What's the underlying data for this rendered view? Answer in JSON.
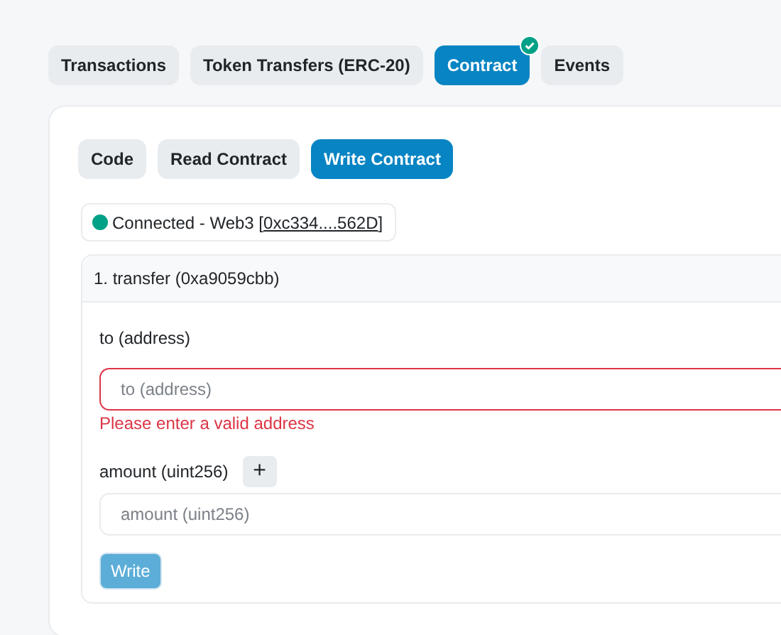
{
  "tabs": [
    {
      "label": "Transactions",
      "selected": false,
      "verified": false
    },
    {
      "label": "Token Transfers (ERC-20)",
      "selected": false,
      "verified": false
    },
    {
      "label": "Contract",
      "selected": true,
      "verified": true
    },
    {
      "label": "Events",
      "selected": false,
      "verified": false
    }
  ],
  "subtabs": [
    {
      "label": "Code",
      "selected": false
    },
    {
      "label": "Read Contract",
      "selected": false
    },
    {
      "label": "Write Contract",
      "selected": true
    }
  ],
  "connection": {
    "connected": true,
    "prefix": "Connected - Web3 [",
    "address": "0xc334....562D",
    "suffix": "]"
  },
  "method": {
    "title": "1. transfer (0xa9059cbb)",
    "inputs": [
      {
        "label": "to (address)",
        "placeholder": "to (address)",
        "invalid": true,
        "error": "Please enter a valid address"
      },
      {
        "label": "amount (uint256)",
        "placeholder": "amount (uint256)",
        "invalid": false,
        "expand_label": "+"
      }
    ],
    "button": {
      "label": "Write",
      "disabled": true
    }
  }
}
